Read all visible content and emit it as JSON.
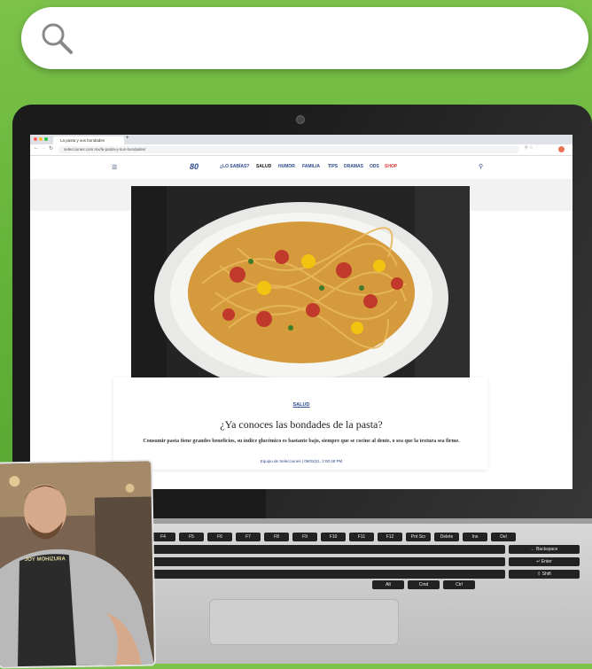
{
  "search": {
    "placeholder": "",
    "value": ""
  },
  "browser": {
    "tab_title": "La pasta y sus bondades",
    "new_tab": "+",
    "url": "selecciones.com.mx/la-pasta-y-sus-bondades/"
  },
  "site": {
    "logo": "80",
    "nav": [
      "¿LO SABÍAS?",
      "SALUD",
      "HUMOR",
      "FAMILIA",
      "TIPS",
      "DRAMAS",
      "ODS",
      "SHOP"
    ]
  },
  "article": {
    "category": "SALUD",
    "headline": "¿Ya conoces las bondades de la pasta?",
    "dek": "Consumir pasta tiene grandes beneficios, su índice glucémico es bastante bajo, siempre que se cocine al dente, o sea que la textura sea firme.",
    "byline": "Equipo de Selecciones | 09/02/21, 2:00:48 PM"
  },
  "keyboard": {
    "row1": [
      "F4",
      "F5",
      "F6",
      "F7",
      "F8",
      "F9",
      "F10",
      "F11",
      "F12",
      "Pnt Scr",
      "Delete",
      "Ins",
      "Del"
    ],
    "row2_right": "← Backspace",
    "row3_right": "↵ Enter",
    "row4_right": "⇧ Shift",
    "row5": [
      "Alt",
      "Cmd",
      "Ctrl"
    ]
  },
  "phone": {
    "apron_text": "JOY MOHIZURA"
  },
  "colors": {
    "background": "#64b43a",
    "nav_blue": "#2c4a8c",
    "shop_red": "#e53935"
  }
}
